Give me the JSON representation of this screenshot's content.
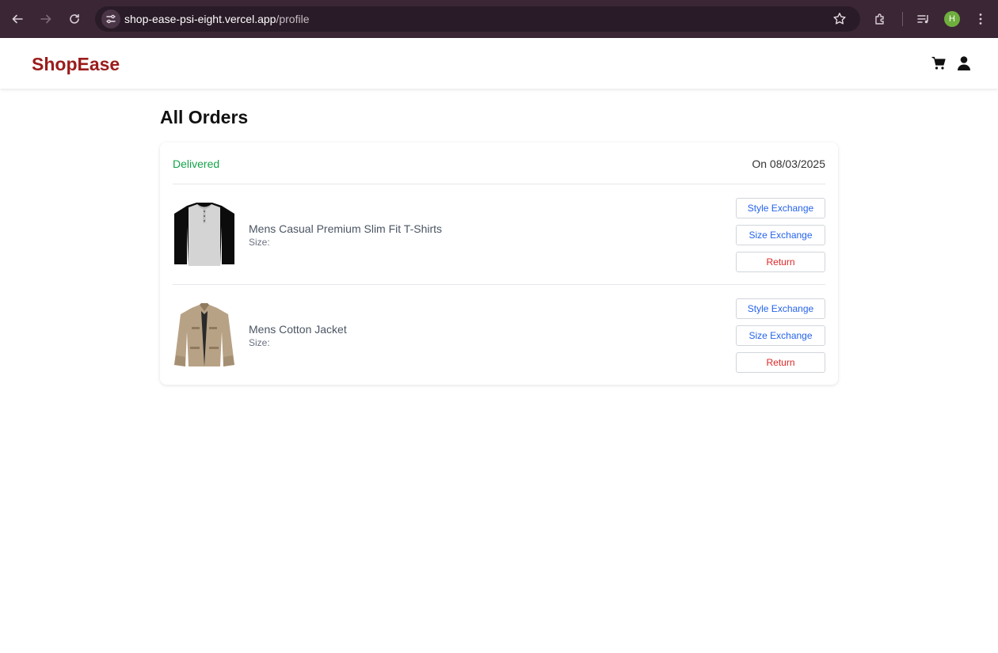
{
  "browser": {
    "url_host": "shop-ease-psi-eight.vercel.app",
    "url_path": "/profile",
    "profile_initial": "H"
  },
  "header": {
    "logo": "ShopEase",
    "logo_color": "#9b1c1c"
  },
  "page": {
    "title": "All Orders"
  },
  "order": {
    "status": "Delivered",
    "status_color": "#16a34a",
    "date": "On 08/03/2025",
    "items": [
      {
        "name": "Mens Casual Premium Slim Fit T-Shirts",
        "size_label": "Size:",
        "thumbnail_icon": "tshirt-thumbnail",
        "buttons": {
          "style": "Style Exchange",
          "size": "Size Exchange",
          "return": "Return"
        }
      },
      {
        "name": "Mens Cotton Jacket",
        "size_label": "Size:",
        "thumbnail_icon": "jacket-thumbnail",
        "buttons": {
          "style": "Style Exchange",
          "size": "Size Exchange",
          "return": "Return"
        }
      }
    ]
  }
}
